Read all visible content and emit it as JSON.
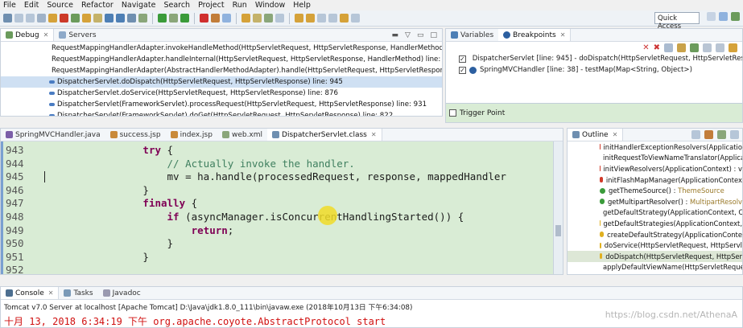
{
  "menu": [
    "File",
    "Edit",
    "Source",
    "Refactor",
    "Navigate",
    "Search",
    "Project",
    "Run",
    "Window",
    "Help"
  ],
  "toolbar": {
    "quick_access": "Quick Access"
  },
  "debug_panel": {
    "tabs": [
      {
        "label": "Debug",
        "active": true
      },
      {
        "label": "Servers",
        "active": false
      }
    ],
    "stack": [
      {
        "text": "RequestMappingHandlerAdapter.invokeHandleMethod(HttpServletRequest, HttpServletResponse, HandlerMethod) line: 7"
      },
      {
        "text": "RequestMappingHandlerAdapter.handleInternal(HttpServletRequest, HttpServletResponse, HandlerMethod) line: 68"
      },
      {
        "text": "RequestMappingHandlerAdapter(AbstractHandlerMethodAdapter).handle(HttpServletRequest, HttpServletRespons"
      },
      {
        "text": "DispatcherServlet.doDispatch(HttpServletRequest, HttpServletResponse) line: 945",
        "selected": true
      },
      {
        "text": "DispatcherServlet.doService(HttpServletRequest, HttpServletResponse) line: 876"
      },
      {
        "text": "DispatcherServlet(FrameworkServlet).processRequest(HttpServletRequest, HttpServletResponse) line: 931"
      },
      {
        "text": "DispatcherServlet(FrameworkServlet).doGet(HttpServletRequest, HttpServletResponse) line: 822"
      }
    ]
  },
  "breakpoints_panel": {
    "tabs": [
      {
        "label": "Variables",
        "active": false
      },
      {
        "label": "Breakpoints",
        "active": true
      }
    ],
    "items": [
      {
        "label": "DispatcherServlet [line: 945] - doDispatch(HttpServletRequest, HttpServletResponse",
        "checked": true
      },
      {
        "label": "SpringMVCHandler [line: 38] - testMap(Map<String, Object>)",
        "checked": true
      }
    ],
    "trigger_point": "Trigger Point"
  },
  "editor": {
    "tabs": [
      {
        "label": "SpringMVCHandler.java",
        "active": false
      },
      {
        "label": "success.jsp",
        "active": false
      },
      {
        "label": "index.jsp",
        "active": false
      },
      {
        "label": "web.xml",
        "active": false
      },
      {
        "label": "DispatcherServlet.class",
        "active": true
      }
    ],
    "lines": [
      {
        "num": "943",
        "indent": "                ",
        "parts": [
          {
            "t": "try",
            "c": "kw"
          },
          {
            "t": " {",
            "c": ""
          }
        ]
      },
      {
        "num": "944",
        "indent": "                    ",
        "parts": [
          {
            "t": "// Actually invoke the handler.",
            "c": "cm"
          }
        ]
      },
      {
        "num": "945",
        "indent": "                    ",
        "parts": [
          {
            "t": "mv = ha.handle(processedRequest, response, mappedHandler",
            "c": ""
          }
        ]
      },
      {
        "num": "946",
        "indent": "                ",
        "parts": [
          {
            "t": "}",
            "c": ""
          }
        ]
      },
      {
        "num": "947",
        "indent": "                ",
        "parts": [
          {
            "t": "finally",
            "c": "kw"
          },
          {
            "t": " {",
            "c": ""
          }
        ]
      },
      {
        "num": "948",
        "indent": "                    ",
        "parts": [
          {
            "t": "if",
            "c": "kw"
          },
          {
            "t": " (asyncManager.isConcurrentHandlingStarted()) {",
            "c": ""
          }
        ]
      },
      {
        "num": "949",
        "indent": "                        ",
        "parts": [
          {
            "t": "return",
            "c": "kw"
          },
          {
            "t": ";",
            "c": ""
          }
        ]
      },
      {
        "num": "950",
        "indent": "                    ",
        "parts": [
          {
            "t": "}",
            "c": ""
          }
        ]
      },
      {
        "num": "951",
        "indent": "                ",
        "parts": [
          {
            "t": "}",
            "c": ""
          }
        ]
      },
      {
        "num": "952",
        "indent": "",
        "parts": []
      }
    ]
  },
  "outline": {
    "tabs": [
      {
        "label": "Outline",
        "active": true
      }
    ],
    "items": [
      {
        "name": "initHandlerExceptionResolvers(Applicatio",
        "type": "",
        "icon": "private"
      },
      {
        "name": "initRequestToViewNameTranslator(Applica",
        "type": "",
        "icon": "private"
      },
      {
        "name": "initViewResolvers(ApplicationContext) : v",
        "type": "",
        "icon": "private"
      },
      {
        "name": "initFlashMapManager(ApplicationContex",
        "type": "",
        "icon": "private"
      },
      {
        "name": "getThemeSource() : ",
        "type": "ThemeSource",
        "icon": "public"
      },
      {
        "name": "getMultipartResolver() : ",
        "type": "MultipartResolv",
        "icon": "public"
      },
      {
        "name": "getDefaultStrategy(ApplicationContext, C",
        "type": "",
        "icon": "protected"
      },
      {
        "name": "getDefaultStrategies(ApplicationContext,",
        "type": "",
        "icon": "protected"
      },
      {
        "name": "createDefaultStrategy(ApplicationConte",
        "type": "",
        "icon": "protected"
      },
      {
        "name": "doService(HttpServletRequest, HttpServl",
        "type": "",
        "icon": "protected"
      },
      {
        "name": "doDispatch(HttpServletRequest, HttpSer",
        "type": "",
        "icon": "protected",
        "selected": true
      },
      {
        "name": "applyDefaultViewName(HttpServletReque",
        "type": "",
        "icon": "private"
      }
    ]
  },
  "console": {
    "tabs": [
      {
        "label": "Console",
        "active": true
      },
      {
        "label": "Tasks",
        "active": false
      },
      {
        "label": "Javadoc",
        "active": false
      }
    ],
    "header": "Tomcat v7.0 Server at localhost [Apache Tomcat] D:\\Java\\jdk1.8.0_111\\bin\\javaw.exe (2018年10月13日 下午6:34:08)",
    "line": "十月 13, 2018 6:34:19 下午 org.apache.coyote.AbstractProtocol start",
    "watermark": "https://blog.csdn.net/AthenaA"
  },
  "colors": {
    "private": "#d23b2a",
    "public": "#3a9b3a",
    "protected": "#e0b020",
    "console_red": "#d01010",
    "editor_bg": "#d9ecd5"
  }
}
